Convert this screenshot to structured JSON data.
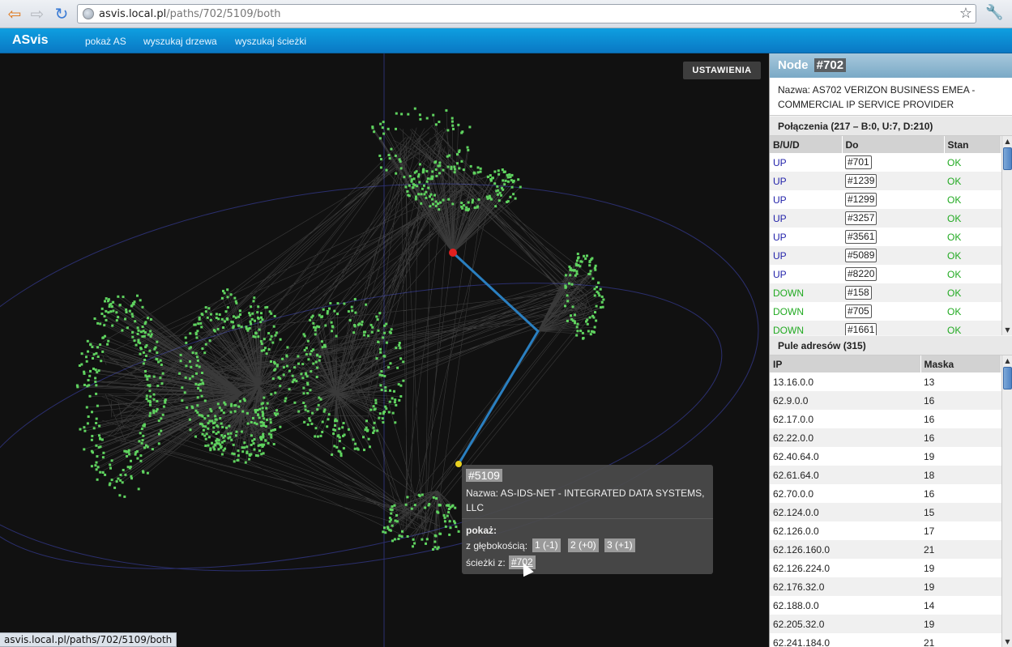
{
  "browser": {
    "url_host": "asvis.local.pl",
    "url_path": "/paths/702/5109/both",
    "status_url": "asvis.local.pl/paths/702/5109/both"
  },
  "nav": {
    "brand": "ASvis",
    "links": [
      "pokaż AS",
      "wyszukaj drzewa",
      "wyszukaj ścieżki"
    ]
  },
  "viz": {
    "settings_label": "USTAWIENIA"
  },
  "tooltip": {
    "id": "#5109",
    "name": "Nazwa: AS-IDS-NET - INTEGRATED DATA SYSTEMS, LLC",
    "show_label": "pokaż:",
    "depth_label": "z głębokością:",
    "depth_buttons": [
      "1 (-1)",
      "2 (+0)",
      "3 (+1)"
    ],
    "paths_label": "ścieżki z:",
    "paths_target": "#702"
  },
  "panel": {
    "node_label": "Node",
    "node_id": "#702",
    "node_name": "Nazwa: AS702 VERIZON BUSINESS EMEA - COMMERCIAL IP SERVICE PROVIDER",
    "connections_title": "Połączenia (217 – B:0, U:7, D:210)",
    "connections_headers": [
      "B/U/D",
      "Do",
      "Stan"
    ],
    "connections": [
      {
        "dir": "UP",
        "to": "#701",
        "state": "OK"
      },
      {
        "dir": "UP",
        "to": "#1239",
        "state": "OK"
      },
      {
        "dir": "UP",
        "to": "#1299",
        "state": "OK"
      },
      {
        "dir": "UP",
        "to": "#3257",
        "state": "OK"
      },
      {
        "dir": "UP",
        "to": "#3561",
        "state": "OK"
      },
      {
        "dir": "UP",
        "to": "#5089",
        "state": "OK"
      },
      {
        "dir": "UP",
        "to": "#8220",
        "state": "OK"
      },
      {
        "dir": "DOWN",
        "to": "#158",
        "state": "OK"
      },
      {
        "dir": "DOWN",
        "to": "#705",
        "state": "OK"
      },
      {
        "dir": "DOWN",
        "to": "#1661",
        "state": "OK"
      }
    ],
    "pools_title": "Pule adresów (315)",
    "pools_headers": [
      "IP",
      "Maska"
    ],
    "pools": [
      {
        "ip": "13.16.0.0",
        "mask": "13"
      },
      {
        "ip": "62.9.0.0",
        "mask": "16"
      },
      {
        "ip": "62.17.0.0",
        "mask": "16"
      },
      {
        "ip": "62.22.0.0",
        "mask": "16"
      },
      {
        "ip": "62.40.64.0",
        "mask": "19"
      },
      {
        "ip": "62.61.64.0",
        "mask": "18"
      },
      {
        "ip": "62.70.0.0",
        "mask": "16"
      },
      {
        "ip": "62.124.0.0",
        "mask": "15"
      },
      {
        "ip": "62.126.0.0",
        "mask": "17"
      },
      {
        "ip": "62.126.160.0",
        "mask": "21"
      },
      {
        "ip": "62.126.224.0",
        "mask": "19"
      },
      {
        "ip": "62.176.32.0",
        "mask": "19"
      },
      {
        "ip": "62.188.0.0",
        "mask": "14"
      },
      {
        "ip": "62.205.32.0",
        "mask": "19"
      },
      {
        "ip": "62.241.184.0",
        "mask": "21"
      }
    ]
  },
  "colors": {
    "node_green": "#5fd35f",
    "highlight_red": "#e02020",
    "highlight_yellow": "#e8d020",
    "path_blue": "#2a7fc0",
    "orbit": "#2b2f6e"
  }
}
